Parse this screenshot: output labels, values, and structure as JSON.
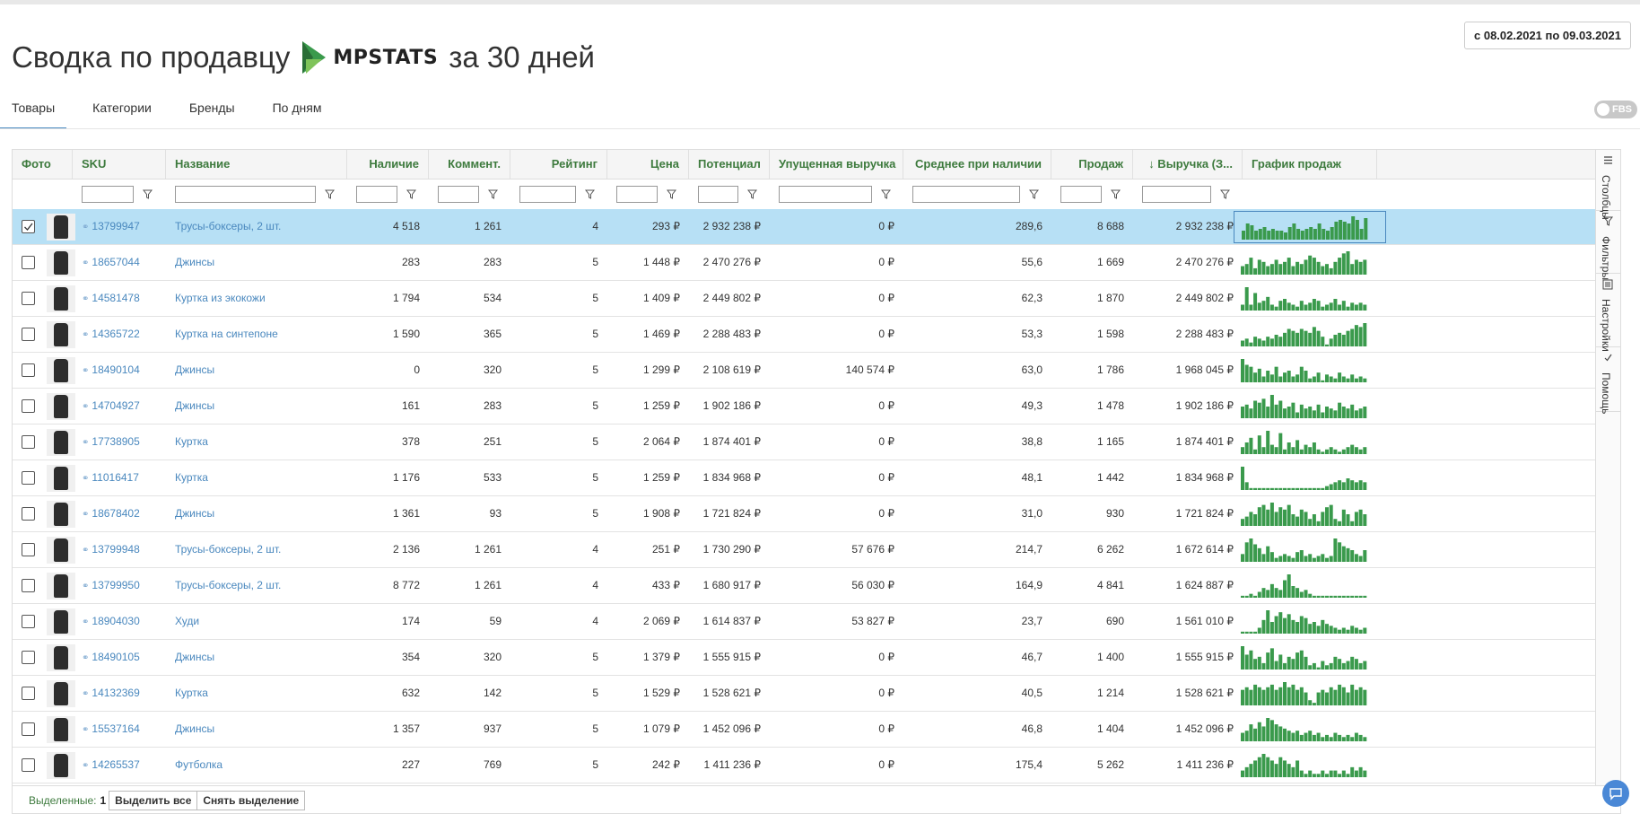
{
  "page": {
    "title_prefix": "Сводка по продавцу",
    "logo_text": "MPSTATS",
    "title_suffix": "за 30 дней",
    "date_range": "с 08.02.2021 по 09.03.2021",
    "fbs_label": "FBS"
  },
  "tabs": [
    {
      "label": "Товары",
      "active": true
    },
    {
      "label": "Категории",
      "active": false
    },
    {
      "label": "Бренды",
      "active": false
    },
    {
      "label": "По дням",
      "active": false
    }
  ],
  "columns": [
    {
      "label": "Фото"
    },
    {
      "label": "SKU"
    },
    {
      "label": "Название"
    },
    {
      "label": "Наличие"
    },
    {
      "label": "Коммент."
    },
    {
      "label": "Рейтинг"
    },
    {
      "label": "Цена"
    },
    {
      "label": "Потенциал"
    },
    {
      "label": "Упущенная выручка"
    },
    {
      "label": "Среднее при наличии"
    },
    {
      "label": "Продаж"
    },
    {
      "label": "↓ Выручка (З..."
    },
    {
      "label": "График продаж"
    }
  ],
  "rows": [
    {
      "selected": true,
      "sku": "13799947",
      "name": "Трусы-боксеры, 2 шт.",
      "stock": "4 518",
      "comments": "1 261",
      "rating": "4",
      "price": "293 ₽",
      "potential": "2 932 238 ₽",
      "lost": "0 ₽",
      "avg": "289,6",
      "sales": "8 688",
      "revenue": "2 932 238 ₽",
      "trend": [
        5,
        9,
        8,
        5,
        6,
        7,
        5,
        6,
        5,
        5,
        4,
        7,
        9,
        6,
        5,
        6,
        7,
        6,
        9,
        6,
        5,
        7,
        10,
        11,
        10,
        9,
        13,
        11,
        6,
        12
      ]
    },
    {
      "selected": false,
      "sku": "18657044",
      "name": "Джинсы",
      "stock": "283",
      "comments": "283",
      "rating": "5",
      "price": "1 448 ₽",
      "potential": "2 470 276 ₽",
      "lost": "0 ₽",
      "avg": "55,6",
      "sales": "1 669",
      "revenue": "2 470 276 ₽",
      "trend": [
        4,
        5,
        8,
        3,
        7,
        6,
        4,
        5,
        7,
        5,
        6,
        8,
        4,
        6,
        5,
        7,
        9,
        8,
        6,
        4,
        5,
        3,
        6,
        8,
        10,
        11,
        5,
        7,
        6,
        7
      ]
    },
    {
      "selected": false,
      "sku": "14581478",
      "name": "Куртка из экокожи",
      "stock": "1 794",
      "comments": "534",
      "rating": "5",
      "price": "1 409 ₽",
      "potential": "2 449 802 ₽",
      "lost": "0 ₽",
      "avg": "62,3",
      "sales": "1 870",
      "revenue": "2 449 802 ₽",
      "trend": [
        3,
        12,
        3,
        9,
        4,
        5,
        7,
        3,
        2,
        5,
        6,
        4,
        3,
        2,
        5,
        3,
        4,
        6,
        5,
        2,
        3,
        4,
        6,
        3,
        5,
        2,
        4,
        3,
        4,
        3
      ]
    },
    {
      "selected": false,
      "sku": "14365722",
      "name": "Куртка на синтепоне",
      "stock": "1 590",
      "comments": "365",
      "rating": "5",
      "price": "1 469 ₽",
      "potential": "2 288 483 ₽",
      "lost": "0 ₽",
      "avg": "53,3",
      "sales": "1 598",
      "revenue": "2 288 483 ₽",
      "trend": [
        3,
        4,
        2,
        5,
        4,
        3,
        5,
        4,
        6,
        5,
        7,
        9,
        8,
        7,
        9,
        8,
        7,
        10,
        8,
        5,
        1,
        4,
        6,
        7,
        6,
        8,
        9,
        11,
        10,
        12
      ]
    },
    {
      "selected": false,
      "sku": "18490104",
      "name": "Джинсы",
      "stock": "0",
      "comments": "320",
      "rating": "5",
      "price": "1 299 ₽",
      "potential": "2 108 619 ₽",
      "lost": "140 574 ₽",
      "avg": "63,0",
      "sales": "1 786",
      "revenue": "1 968 045 ₽",
      "trend": [
        12,
        9,
        8,
        5,
        7,
        3,
        6,
        4,
        8,
        3,
        5,
        6,
        3,
        4,
        8,
        6,
        2,
        3,
        5,
        1,
        4,
        3,
        2,
        5,
        3,
        2,
        4,
        2,
        3,
        2
      ]
    },
    {
      "selected": false,
      "sku": "14704927",
      "name": "Джинсы",
      "stock": "161",
      "comments": "283",
      "rating": "5",
      "price": "1 259 ₽",
      "potential": "1 902 186 ₽",
      "lost": "0 ₽",
      "avg": "49,3",
      "sales": "1 478",
      "revenue": "1 902 186 ₽",
      "trend": [
        6,
        7,
        5,
        9,
        8,
        10,
        6,
        12,
        7,
        9,
        5,
        6,
        8,
        3,
        7,
        5,
        6,
        4,
        7,
        3,
        6,
        5,
        4,
        8,
        6,
        5,
        7,
        4,
        5,
        6
      ]
    },
    {
      "selected": false,
      "sku": "17738905",
      "name": "Куртка",
      "stock": "378",
      "comments": "251",
      "rating": "5",
      "price": "2 064 ₽",
      "potential": "1 874 401 ₽",
      "lost": "0 ₽",
      "avg": "38,8",
      "sales": "1 165",
      "revenue": "1 874 401 ₽",
      "trend": [
        3,
        5,
        7,
        2,
        8,
        3,
        10,
        4,
        3,
        9,
        2,
        5,
        3,
        6,
        2,
        4,
        3,
        5,
        2,
        1,
        2,
        3,
        2,
        1,
        2,
        3,
        4,
        3,
        2,
        3
      ]
    },
    {
      "selected": false,
      "sku": "11016417",
      "name": "Куртка",
      "stock": "1 176",
      "comments": "533",
      "rating": "5",
      "price": "1 259 ₽",
      "potential": "1 834 968 ₽",
      "lost": "0 ₽",
      "avg": "48,1",
      "sales": "1 442",
      "revenue": "1 834 968 ₽",
      "trend": [
        12,
        4,
        1,
        1,
        1,
        1,
        1,
        1,
        1,
        1,
        1,
        1,
        1,
        1,
        1,
        1,
        1,
        1,
        1,
        1,
        2,
        3,
        4,
        5,
        4,
        6,
        5,
        4,
        5,
        4
      ]
    },
    {
      "selected": false,
      "sku": "18678402",
      "name": "Джинсы",
      "stock": "1 361",
      "comments": "93",
      "rating": "5",
      "price": "1 908 ₽",
      "potential": "1 721 824 ₽",
      "lost": "0 ₽",
      "avg": "31,0",
      "sales": "930",
      "revenue": "1 721 824 ₽",
      "trend": [
        3,
        4,
        6,
        5,
        8,
        9,
        7,
        10,
        6,
        8,
        7,
        9,
        5,
        4,
        7,
        6,
        3,
        5,
        2,
        6,
        8,
        9,
        3,
        2,
        7,
        5,
        2,
        6,
        7,
        5
      ]
    },
    {
      "selected": false,
      "sku": "13799948",
      "name": "Трусы-боксеры, 2 шт.",
      "stock": "2 136",
      "comments": "1 261",
      "rating": "4",
      "price": "251 ₽",
      "potential": "1 730 290 ₽",
      "lost": "57 676 ₽",
      "avg": "214,7",
      "sales": "6 262",
      "revenue": "1 672 614 ₽",
      "trend": [
        4,
        10,
        12,
        9,
        7,
        4,
        8,
        5,
        2,
        3,
        4,
        3,
        2,
        5,
        6,
        3,
        4,
        2,
        3,
        4,
        2,
        3,
        12,
        10,
        8,
        7,
        6,
        4,
        3,
        6
      ]
    },
    {
      "selected": false,
      "sku": "13799950",
      "name": "Трусы-боксеры, 2 шт.",
      "stock": "8 772",
      "comments": "1 261",
      "rating": "4",
      "price": "433 ₽",
      "potential": "1 680 917 ₽",
      "lost": "56 030 ₽",
      "avg": "164,9",
      "sales": "4 841",
      "revenue": "1 624 887 ₽",
      "trend": [
        1,
        1,
        2,
        1,
        3,
        5,
        4,
        7,
        5,
        4,
        9,
        12,
        6,
        5,
        3,
        4,
        2,
        1,
        1,
        1,
        1,
        1,
        1,
        1,
        1,
        1,
        1,
        1,
        1,
        1
      ]
    },
    {
      "selected": false,
      "sku": "18904030",
      "name": "Худи",
      "stock": "174",
      "comments": "59",
      "rating": "4",
      "price": "2 069 ₽",
      "potential": "1 614 837 ₽",
      "lost": "53 827 ₽",
      "avg": "23,7",
      "sales": "690",
      "revenue": "1 561 010 ₽",
      "trend": [
        1,
        1,
        1,
        1,
        3,
        7,
        12,
        6,
        9,
        11,
        8,
        10,
        7,
        6,
        9,
        8,
        5,
        6,
        4,
        7,
        5,
        4,
        3,
        2,
        3,
        2,
        4,
        3,
        2,
        3
      ]
    },
    {
      "selected": false,
      "sku": "18490105",
      "name": "Джинсы",
      "stock": "354",
      "comments": "320",
      "rating": "5",
      "price": "1 379 ₽",
      "potential": "1 555 915 ₽",
      "lost": "0 ₽",
      "avg": "46,7",
      "sales": "1 400",
      "revenue": "1 555 915 ₽",
      "trend": [
        11,
        7,
        9,
        5,
        6,
        3,
        8,
        10,
        4,
        7,
        3,
        6,
        5,
        8,
        9,
        6,
        2,
        3,
        1,
        4,
        2,
        3,
        6,
        5,
        3,
        4,
        6,
        5,
        3,
        4
      ]
    },
    {
      "selected": false,
      "sku": "14132369",
      "name": "Куртка",
      "stock": "632",
      "comments": "142",
      "rating": "5",
      "price": "1 529 ₽",
      "potential": "1 528 621 ₽",
      "lost": "0 ₽",
      "avg": "40,5",
      "sales": "1 214",
      "revenue": "1 528 621 ₽",
      "trend": [
        6,
        7,
        6,
        8,
        7,
        6,
        7,
        8,
        6,
        7,
        9,
        7,
        8,
        6,
        7,
        5,
        2,
        1,
        5,
        6,
        5,
        7,
        6,
        8,
        7,
        5,
        8,
        6,
        7,
        6
      ]
    },
    {
      "selected": false,
      "sku": "15537164",
      "name": "Джинсы",
      "stock": "1 357",
      "comments": "937",
      "rating": "5",
      "price": "1 079 ₽",
      "potential": "1 452 096 ₽",
      "lost": "0 ₽",
      "avg": "46,8",
      "sales": "1 404",
      "revenue": "1 452 096 ₽",
      "trend": [
        4,
        5,
        8,
        6,
        9,
        7,
        11,
        10,
        8,
        7,
        6,
        5,
        4,
        5,
        3,
        4,
        5,
        3,
        4,
        2,
        3,
        2,
        4,
        3,
        2,
        3,
        2,
        4,
        3,
        2
      ]
    },
    {
      "selected": false,
      "sku": "14265537",
      "name": "Футболка",
      "stock": "227",
      "comments": "769",
      "rating": "5",
      "price": "242 ₽",
      "potential": "1 411 236 ₽",
      "lost": "0 ₽",
      "avg": "175,4",
      "sales": "5 262",
      "revenue": "1 411 236 ₽",
      "trend": [
        2,
        3,
        4,
        5,
        6,
        7,
        6,
        5,
        4,
        6,
        5,
        4,
        3,
        5,
        2,
        1,
        2,
        1,
        1,
        2,
        1,
        2,
        2,
        1,
        2,
        1,
        3,
        2,
        3,
        2
      ]
    }
  ],
  "side_panel": [
    {
      "label": "Столбцы"
    },
    {
      "label": "Фильтры"
    },
    {
      "label": "Настройки"
    },
    {
      "label": "Помощь"
    }
  ],
  "footer": {
    "selected_label": "Выделенные:",
    "selected_count": "1",
    "select_all": "Выделить все",
    "clear_selection": "Снять выделение"
  },
  "colors": {
    "header_text": "#3d7a3d",
    "link": "#4a88be",
    "selected_row": "#b7e0f5",
    "bar": "#3a9a4c"
  }
}
